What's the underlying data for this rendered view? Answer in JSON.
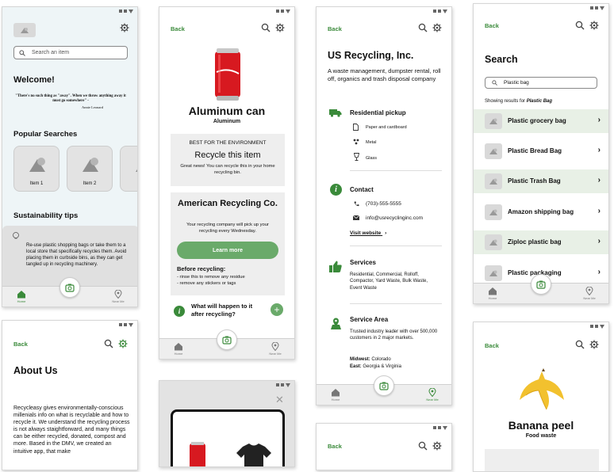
{
  "home": {
    "search_placeholder": "Search an item",
    "welcome": "Welcome!",
    "quote": "\"There's no such thing as \"away\". When we throw anything away it must go somewhere\" -",
    "quote_author": "Annie Leonard",
    "popular_heading": "Popular Searches",
    "items": [
      "Item 1",
      "Item 2"
    ],
    "tips_heading": "Sustainability tips",
    "tip_text": "Re-use plastic shopping bags or take them to a local store that specifically recycles them. Avoid placing them in curbside bins, as they can get tangled up in recycling machinery.",
    "nav": {
      "home": "Home",
      "near_me": "Near Me"
    }
  },
  "product": {
    "back": "Back",
    "title": "Aluminum can",
    "subtitle": "Aluminum",
    "best_label": "BEST FOR THE ENVIRONMENT",
    "best_title": "Recycle this item",
    "best_text": "Great news! You can recycle this in your home recycling bin.",
    "company_title": "American Recycling Co.",
    "company_text": "Your recycling company will pick up your recycling every Wednesday.",
    "learn_more": "Learn more",
    "before_title": "Before recycling:",
    "before_items": [
      "- rinse this to remove any residue",
      "- remove any stickers or tags"
    ],
    "what_happens": "What will happen to it after recycling?",
    "nav": {
      "home": "Home",
      "near_me": "Near Me"
    }
  },
  "company": {
    "back": "Back",
    "title": "US Recycling, Inc.",
    "description": "A waste management, dumpster rental, roll off, organics and trash disposal company",
    "pickup_title": "Residential pickup",
    "pickup_items": [
      "Paper and cardboard",
      "Metal",
      "Glass"
    ],
    "contact_title": "Contact",
    "phone": "(703)-555-5555",
    "email": "info@usrecyclinginc.com",
    "website": "Visit website",
    "services_title": "Services",
    "services_text": "Residential, Commercial, Rolloff, Compactor, Yard Waste, Bulk Waste, Event Waste",
    "area_title": "Service Area",
    "area_text": "Trusted industry leader with over 500,000 customers in 2 major markets.",
    "midwest_label": "Midwest:",
    "midwest_value": "Colorado",
    "east_label": "East:",
    "east_value": "Georgia & Virginia",
    "nav": {
      "home": "Home",
      "near_me": "Near Me"
    }
  },
  "search": {
    "back": "Back",
    "title": "Search",
    "query": "Plastic bag",
    "results_prefix": "Showing results for",
    "results_term": "Plastic Bag",
    "results": [
      "Plastic grocery bag",
      "Plastic Bread Bag",
      "Plastic Trash Bag",
      "Amazon shipping bag",
      "Ziploc plastic bag",
      "Plastic packaging"
    ],
    "nav": {
      "home": "Home",
      "near_me": "Near Me"
    }
  },
  "about": {
    "back": "Back",
    "title": "About Us",
    "body": "Recycleasy gives environmentally-conscious millenials info on what is recyclable and how to recycle it. We understand the recycling process is not always staightforward, and many things can be either recycled, donated, compost and more. Based in the DMV, we created an intuitive app, that make"
  },
  "banana": {
    "back": "Back",
    "title": "Banana peel",
    "subtitle": "Food waste"
  },
  "bottom_company": {
    "back": "Back"
  },
  "colors": {
    "accent": "#3a8a3a",
    "button": "#6aaa6a",
    "tip_bg": "#e9f1f3",
    "home_bg": "#eaf3f6"
  }
}
